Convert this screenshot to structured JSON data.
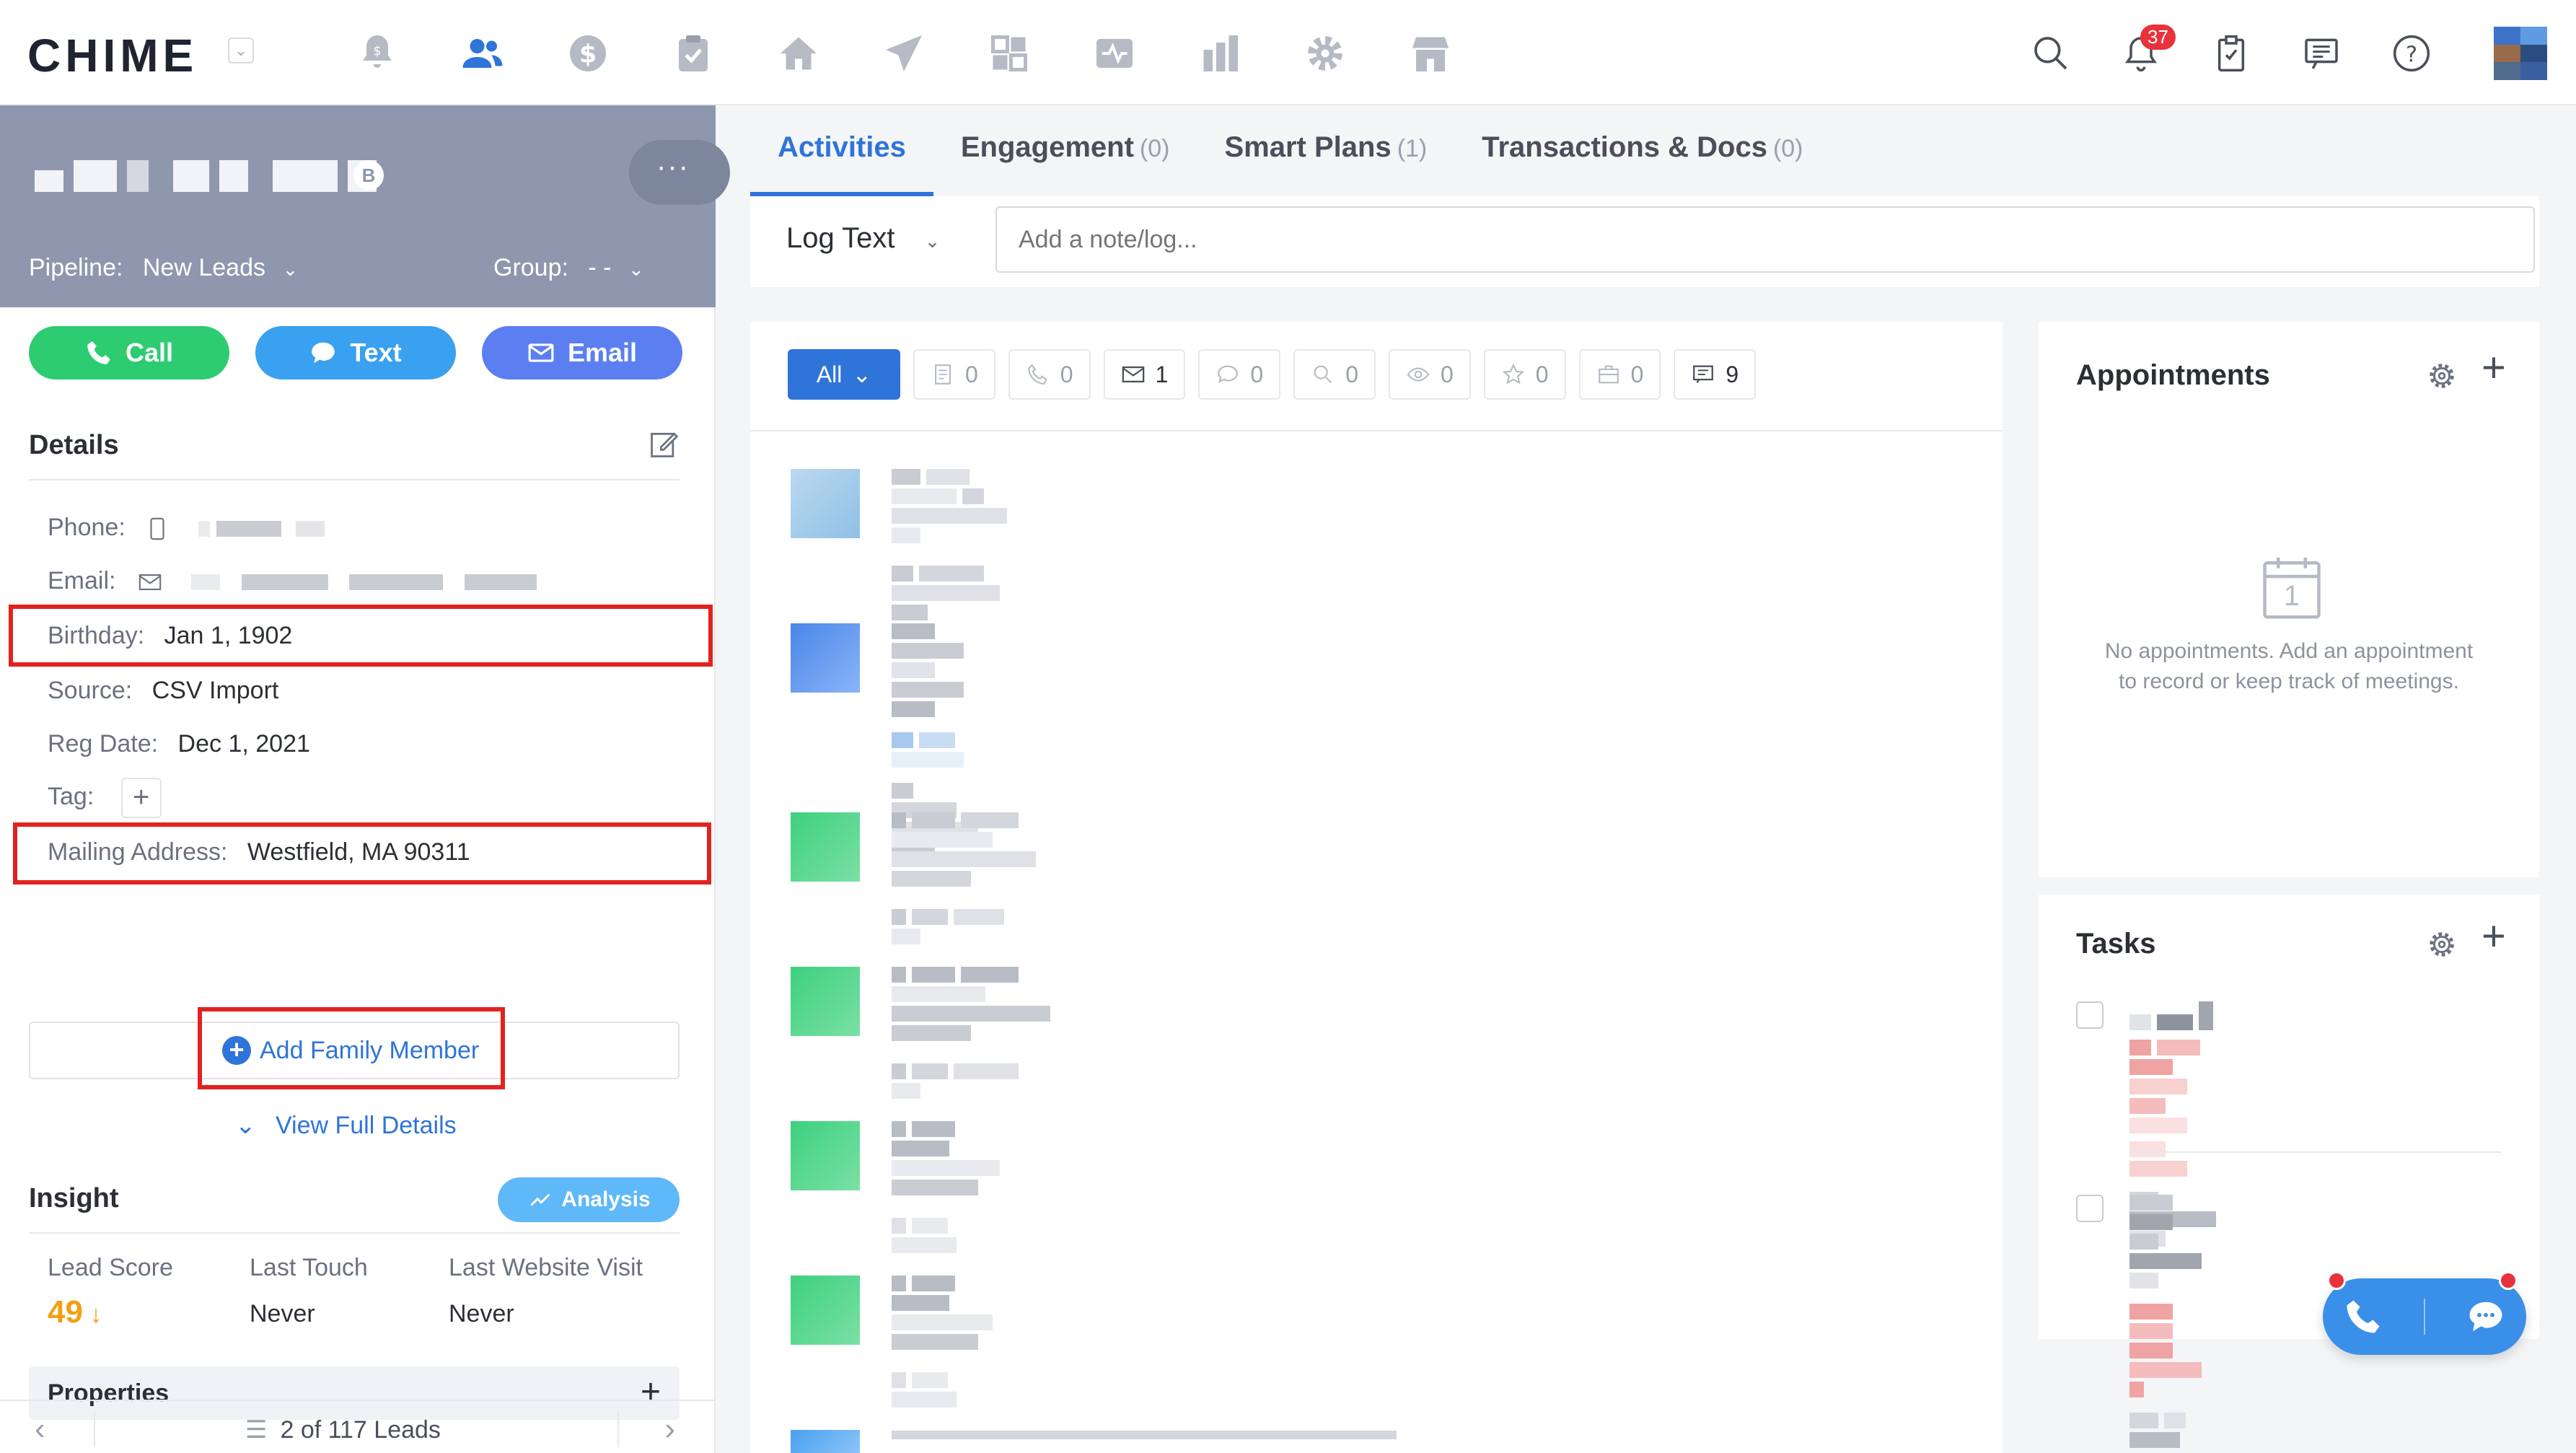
{
  "app": {
    "logo": "CHIME",
    "notifications_count": "37"
  },
  "nav_icons": [
    "bell-dollar-icon",
    "contacts-icon",
    "dollar-icon",
    "clipboard-check-icon",
    "home-icon",
    "paper-plane-icon",
    "dashboard-icon",
    "activity-icon",
    "bar-chart-icon",
    "gear-icon",
    "store-icon"
  ],
  "lead": {
    "badge": "B",
    "more": "···",
    "pipeline_label": "Pipeline:",
    "pipeline_value": "New Leads",
    "group_label": "Group:",
    "group_value": "- -",
    "actions": {
      "call": "Call",
      "text": "Text",
      "email": "Email"
    }
  },
  "details": {
    "title": "Details",
    "phone_label": "Phone:",
    "email_label": "Email:",
    "birthday_label": "Birthday:",
    "birthday_value": "Jan 1, 1902",
    "source_label": "Source:",
    "source_value": "CSV Import",
    "reg_label": "Reg Date:",
    "reg_value": "Dec 1, 2021",
    "tag_label": "Tag:",
    "tag_plus": "+",
    "mailing_label": "Mailing Address:",
    "mailing_value": "Westfield, MA 90311",
    "add_family": "Add Family Member",
    "view_full": "View Full Details"
  },
  "insight": {
    "title": "Insight",
    "analysis": "Analysis",
    "lead_score_label": "Lead Score",
    "lead_score_value": "49",
    "lead_score_arrow": "↓",
    "last_touch_label": "Last Touch",
    "last_touch_value": "Never",
    "last_visit_label": "Last Website Visit",
    "last_visit_value": "Never"
  },
  "properties": {
    "title": "Properties",
    "plus": "+"
  },
  "pager": {
    "text": "2 of 117 Leads",
    "prev": "‹",
    "next": "›"
  },
  "tabs": [
    {
      "label": "Activities",
      "count": ""
    },
    {
      "label": "Engagement",
      "count": "(0)"
    },
    {
      "label": "Smart Plans",
      "count": "(1)"
    },
    {
      "label": "Transactions & Docs",
      "count": "(0)"
    }
  ],
  "log": {
    "type": "Log Text",
    "placeholder": "Add a note/log..."
  },
  "filters": {
    "all": "All",
    "chips": [
      {
        "icon": "note-icon",
        "count": "0"
      },
      {
        "icon": "phone-icon",
        "count": "0"
      },
      {
        "icon": "mail-icon",
        "count": "1"
      },
      {
        "icon": "chat-icon",
        "count": "0"
      },
      {
        "icon": "search-icon",
        "count": "0"
      },
      {
        "icon": "eye-icon",
        "count": "0"
      },
      {
        "icon": "star-icon",
        "count": "0"
      },
      {
        "icon": "briefcase-icon",
        "count": "0"
      },
      {
        "icon": "message-icon",
        "count": "9"
      }
    ]
  },
  "appointments": {
    "title": "Appointments",
    "empty_day": "1",
    "empty_text": "No appointments. Add an appointment to record or keep track of meetings."
  },
  "tasks": {
    "title": "Tasks"
  },
  "colors": {
    "primary": "#2f74d8",
    "call": "#2ecc71",
    "text": "#3aa0f0",
    "email": "#5b7ff0",
    "header": "#8e97ad",
    "highlight": "#e0231f",
    "lead_score": "#f0a014"
  }
}
